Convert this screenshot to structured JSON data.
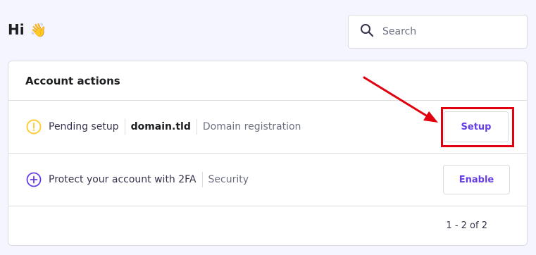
{
  "header": {
    "greeting": "Hi",
    "wave_emoji": "👋"
  },
  "search": {
    "placeholder": "Search",
    "value": ""
  },
  "account_actions": {
    "title": "Account actions",
    "rows": [
      {
        "status": "Pending setup",
        "domain": "domain.tld",
        "category": "Domain registration",
        "button": "Setup",
        "icon": "warning-circle-icon"
      },
      {
        "status": "Protect your account with 2FA",
        "category": "Security",
        "button": "Enable",
        "icon": "plus-circle-icon"
      }
    ],
    "pagination": "1 - 2 of 2"
  },
  "colors": {
    "accent": "#673de6",
    "warning": "#ffcd35",
    "highlight": "#e1000f",
    "background": "#f4f5ff"
  }
}
